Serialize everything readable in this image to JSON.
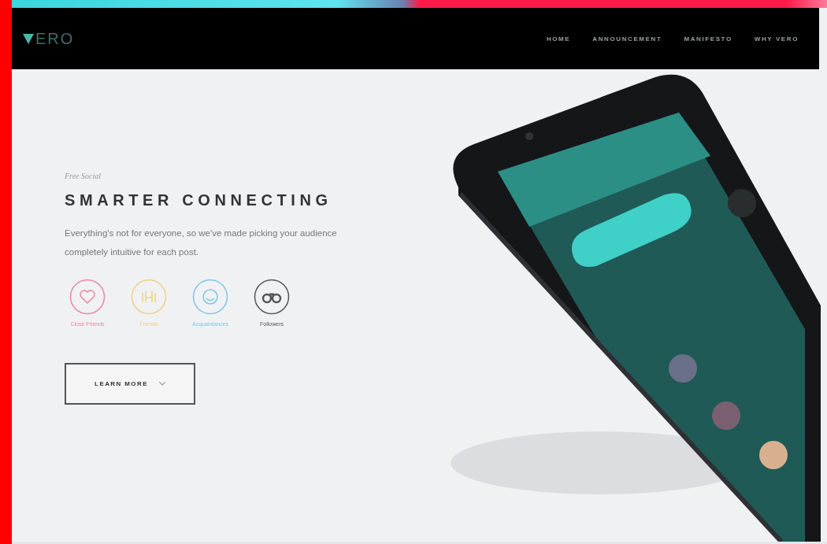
{
  "nav": {
    "logo": "ERO",
    "links": [
      "HOME",
      "ANNOUNCEMENT",
      "MANIFESTO",
      "WHY VERO"
    ]
  },
  "hero": {
    "eyebrow": "Free Social",
    "title": "SMARTER CONNECTING",
    "text": "Everything's not for everyone, so we've made picking your audience completely intuitive for each post.",
    "audiences": [
      {
        "kind": "heart",
        "label": "Close Friends",
        "color": "#e8879f"
      },
      {
        "kind": "hands",
        "label": "Friends",
        "color": "#f0d080"
      },
      {
        "kind": "smile",
        "label": "Acquaintances",
        "color": "#7fc6e0"
      },
      {
        "kind": "binoculars",
        "label": "Followers",
        "color": "#555555"
      }
    ],
    "button": "LEARN MORE"
  }
}
